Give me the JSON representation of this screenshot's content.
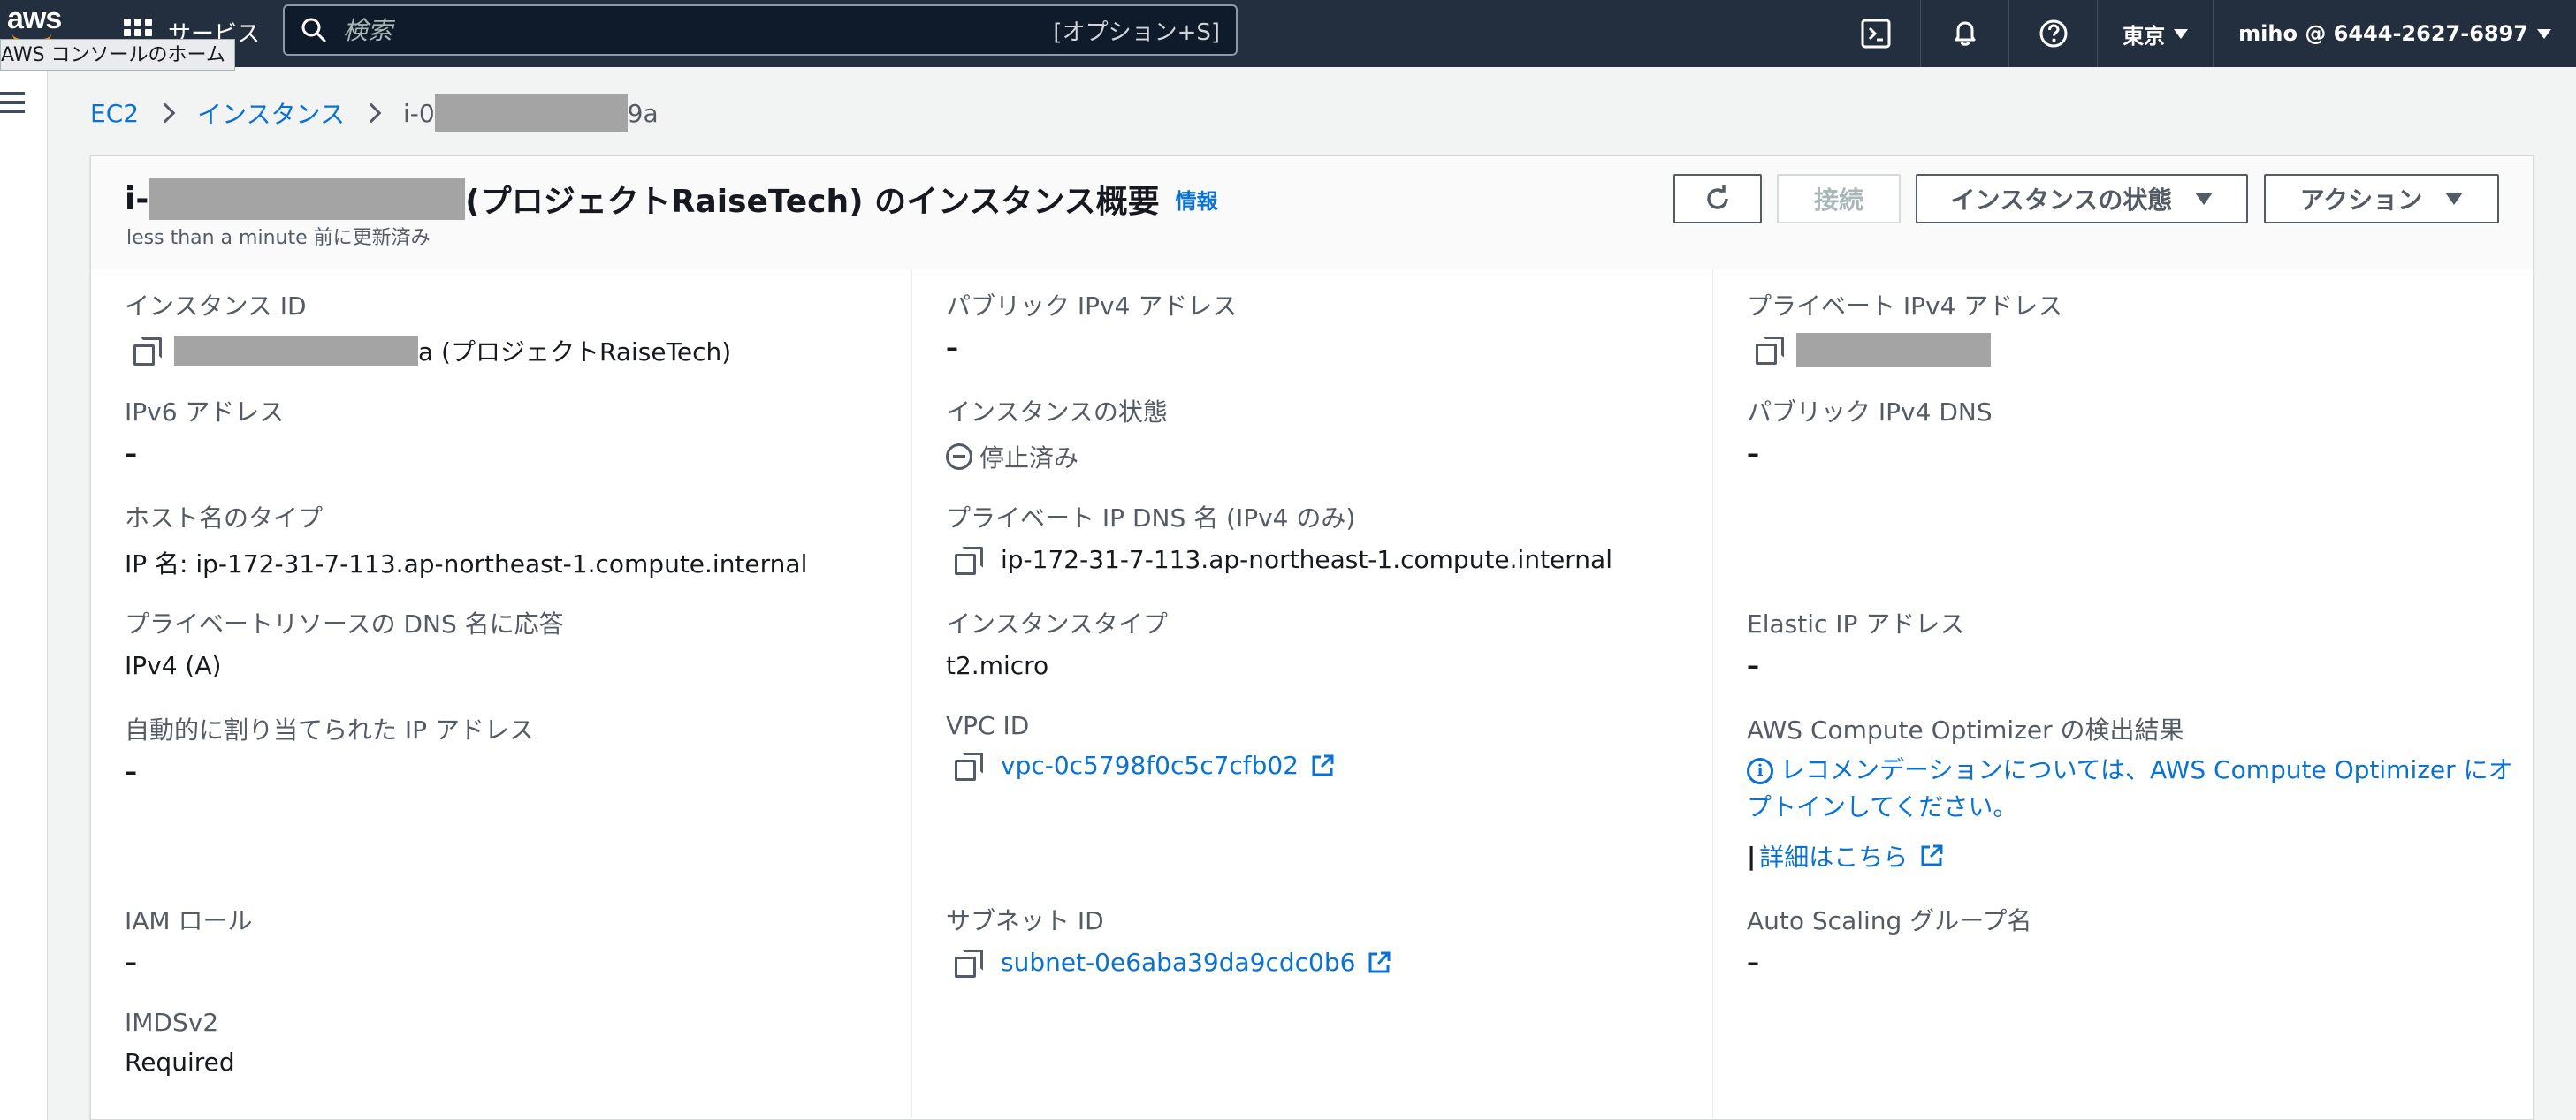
{
  "topnav": {
    "logo_text": "aws",
    "home_tooltip": "AWS コンソールのホーム",
    "services_label": "サービス",
    "search_placeholder": "検索",
    "search_shortcut": "[オプション+S]",
    "region": "東京",
    "account": "miho @ 6444-2627-6897",
    "icons": [
      "cloudshell-icon",
      "bell-icon",
      "help-icon"
    ]
  },
  "breadcrumb": {
    "items": [
      "EC2",
      "インスタンス"
    ],
    "current_prefix": "i-0",
    "current_suffix": "9a"
  },
  "panel": {
    "title_prefix": "i-",
    "title_suffix": "(プロジェクトRaiseTech) のインスタンス概要",
    "info_label": "情報",
    "subtitle": "less than a minute 前に更新済み",
    "buttons": {
      "connect": "接続",
      "instance_state": "インスタンスの状態",
      "actions": "アクション"
    }
  },
  "details": {
    "col1": [
      {
        "label": "インスタンス ID",
        "value_suffix": "a (プロジェクトRaiseTech)"
      },
      {
        "label": "IPv6 アドレス",
        "value": "–"
      },
      {
        "label": "ホスト名のタイプ",
        "value": "IP 名: ip-172-31-7-113.ap-northeast-1.compute.internal"
      },
      {
        "label": "プライベートリソースの DNS 名に応答",
        "value": "IPv4 (A)"
      },
      {
        "label": "自動的に割り当てられた IP アドレス",
        "value": "–"
      },
      {
        "label": "IAM ロール",
        "value": "–"
      },
      {
        "label": "IMDSv2",
        "value": "Required"
      }
    ],
    "col2": [
      {
        "label": "パブリック IPv4 アドレス",
        "value": "–"
      },
      {
        "label": "インスタンスの状態",
        "value": "停止済み"
      },
      {
        "label": "プライベート IP DNS 名 (IPv4 のみ)",
        "value": "ip-172-31-7-113.ap-northeast-1.compute.internal"
      },
      {
        "label": "インスタンスタイプ",
        "value": "t2.micro"
      },
      {
        "label": "VPC ID",
        "value": "vpc-0c5798f0c5c7cfb02"
      },
      {
        "label": "サブネット ID",
        "value": "subnet-0e6aba39da9cdc0b6"
      }
    ],
    "col3": [
      {
        "label": "プライベート IPv4 アドレス"
      },
      {
        "label": "パブリック IPv4 DNS",
        "value": "–"
      },
      {
        "label": "Elastic IP アドレス",
        "value": "–"
      },
      {
        "label": "AWS Compute Optimizer の検出結果",
        "value": "レコメンデーションについては、AWS Compute Optimizer にオプトインしてください。",
        "link": "詳細はこちら",
        "bar": "|"
      },
      {
        "label": "Auto Scaling グループ名",
        "value": "–"
      }
    ]
  },
  "colors": {
    "nav_bg": "#232f3e",
    "link": "#0972d3",
    "brand_orange": "#ff9900",
    "text_secondary": "#545b64"
  }
}
